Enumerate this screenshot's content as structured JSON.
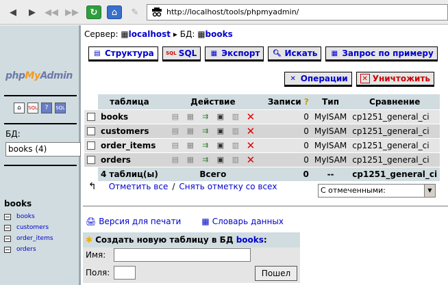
{
  "browser": {
    "url": "http://localhost/tools/phpmyadmin/",
    "icons": [
      "back-icon",
      "forward-icon",
      "skip-back-icon",
      "skip-forward-icon",
      "reload-icon",
      "home-icon",
      "pen-icon",
      "incognito-icon"
    ]
  },
  "left": {
    "logo": {
      "part1": "php",
      "part2": "My",
      "part3": "Admin"
    },
    "db_label": "БД:",
    "db_select": "books (4)",
    "db_title": "books",
    "tables": [
      "books",
      "customers",
      "order_items",
      "orders"
    ]
  },
  "breadcrumb": {
    "server_label": "Сервер:",
    "server": "localhost",
    "db_label": "БД:",
    "db": "books"
  },
  "tabs": {
    "structure": "Структура",
    "sql": "SQL",
    "export": "Экспорт",
    "search": "Искать",
    "query": "Запрос по примеру",
    "operations": "Операции",
    "drop": "Уничтожить"
  },
  "table": {
    "headers": {
      "table": "таблица",
      "action": "Действие",
      "records": "Записи",
      "type": "Тип",
      "collation": "Сравнение"
    },
    "rows": [
      {
        "name": "books",
        "records": "0",
        "type": "MyISAM",
        "collation": "cp1251_general_ci"
      },
      {
        "name": "customers",
        "records": "0",
        "type": "MyISAM",
        "collation": "cp1251_general_ci"
      },
      {
        "name": "order_items",
        "records": "0",
        "type": "MyISAM",
        "collation": "cp1251_general_ci"
      },
      {
        "name": "orders",
        "records": "0",
        "type": "MyISAM",
        "collation": "cp1251_general_ci"
      }
    ],
    "footer": {
      "count": "4 таблиц(ы)",
      "total_label": "Всего",
      "records": "0",
      "type": "--",
      "collation": "cp1251_general_ci"
    }
  },
  "actions": {
    "check_all": "Отметить все",
    "separator": "/",
    "uncheck_all": "Снять отметку со всех",
    "with_selected": "С отмеченными:"
  },
  "links": {
    "print": "Версия для печати",
    "dictionary": "Словарь данных"
  },
  "create": {
    "title": "Создать новую таблицу в БД",
    "db": "books",
    "title_suffix": ":",
    "name_label": "Имя:",
    "fields_label": "Поля:",
    "go": "Пошел"
  }
}
